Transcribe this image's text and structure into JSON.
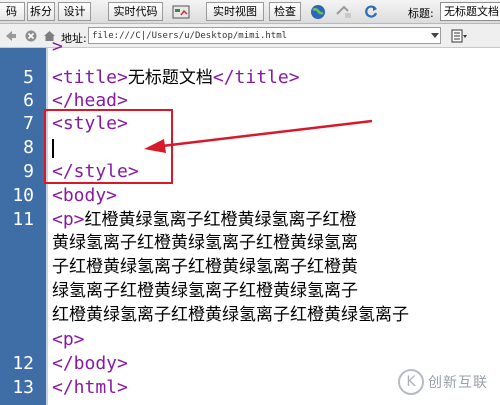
{
  "toolbar": {
    "code_btn": "码",
    "split_btn": "拆分",
    "design_btn": "设计",
    "live_code_btn": "实时代码",
    "live_view_btn": "实时视图",
    "inspect_btn": "检查",
    "title_label": "标题:",
    "title_value": "无标题文档"
  },
  "address": {
    "label": "地址:",
    "url": "file:///C|/Users/u/Desktop/mimi.html"
  },
  "editor": {
    "lines": [
      {
        "num": "5",
        "a": "<title>",
        "b": "无标题文档",
        "c": "</title>"
      },
      {
        "num": "6",
        "a": "</head>"
      },
      {
        "num": "7",
        "a": "<style>"
      },
      {
        "num": "8",
        "a": ""
      },
      {
        "num": "9",
        "a": "</style>"
      },
      {
        "num": "10",
        "a": "<body>"
      },
      {
        "num": "11",
        "a": "<p>",
        "b": "红橙黄绿氢离子红橙黄绿氢离子红橙"
      },
      {
        "num": "12",
        "a": "</body>"
      },
      {
        "num": "13",
        "a": "</html>"
      }
    ],
    "wrapped": [
      "黄绿氢离子红橙黄绿氢离子红橙黄绿氢离",
      "子红橙黄绿氢离子红橙黄绿氢离子红橙黄",
      "绿氢离子红橙黄绿氢离子红橙黄绿氢离子",
      "红橙黄绿氢离子红橙黄绿氢离子红橙黄绿氢离子"
    ],
    "p_line": "<p>"
  },
  "watermark": {
    "text": "创新互联",
    "mark": "K"
  },
  "colors": {
    "gutter": "#3f6ea7",
    "tag": "#871aa3",
    "annotation": "#d9182a"
  }
}
